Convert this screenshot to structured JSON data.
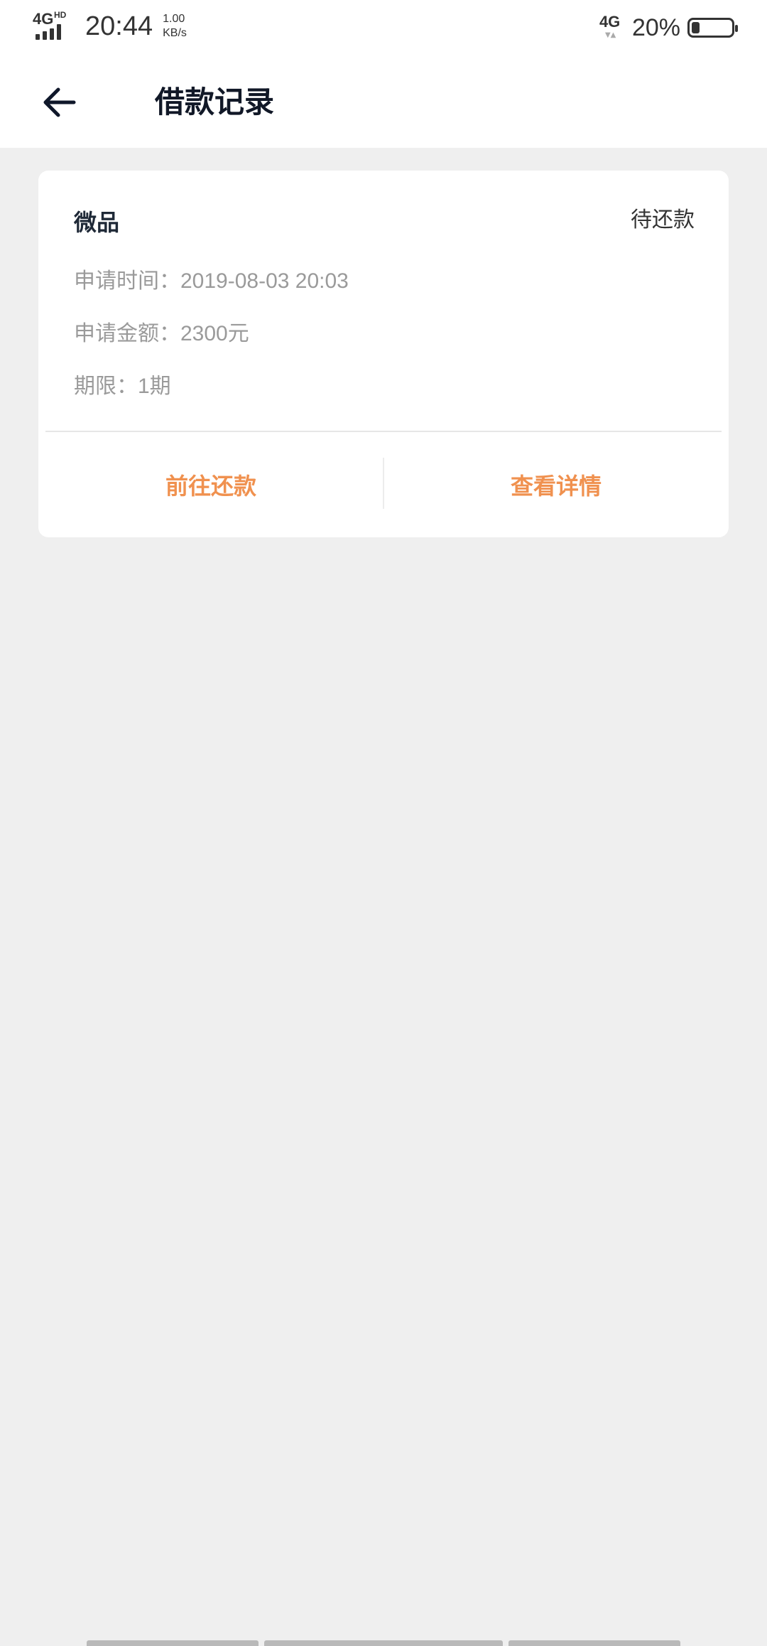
{
  "status_bar": {
    "network_type": "4G",
    "network_hd": "HD",
    "time": "20:44",
    "speed_value": "1.00",
    "speed_unit": "KB/s",
    "network_type_right": "4G",
    "battery_percent": "20%",
    "battery_level": 0.2
  },
  "app_bar": {
    "back_icon": "back-arrow-icon",
    "title": "借款记录"
  },
  "loan_record": {
    "product": "微品",
    "status": "待还款",
    "apply_time_label": "申请时间：",
    "apply_time_value": "2019-08-03 20:03",
    "apply_amount_label": "申请金额：",
    "apply_amount_value": "2300元",
    "term_label": "期限：",
    "term_value": "1期",
    "actions": {
      "repay": "前往还款",
      "details": "查看详情"
    }
  },
  "colors": {
    "background": "#efefef",
    "card": "#ffffff",
    "accent": "#f0914f",
    "muted_text": "#9a9a9a"
  }
}
